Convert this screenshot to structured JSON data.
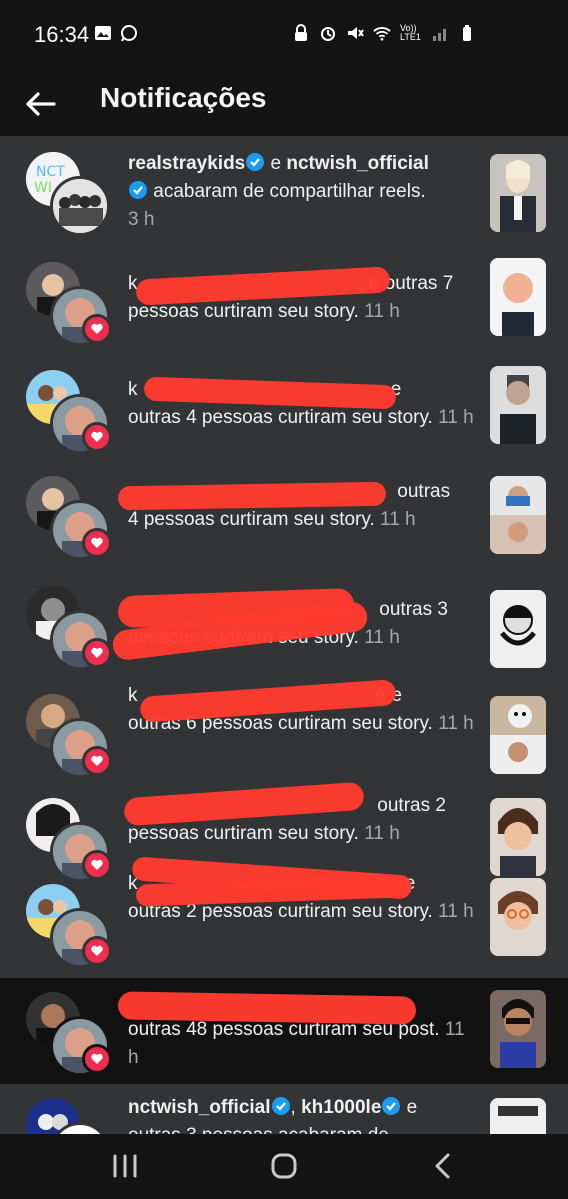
{
  "status_bar": {
    "time": "16:34",
    "left_icons": [
      "image-icon",
      "whatsapp-icon"
    ],
    "right_icons": [
      "lock-icon",
      "alarm-icon",
      "mute-icon",
      "wifi-icon",
      "volte-icon",
      "signal-icon",
      "battery-icon"
    ],
    "volte_label": "Vo)) LTE1"
  },
  "header": {
    "title": "Notificações"
  },
  "notifications": [
    {
      "user1": "realstraykids",
      "connector": " e ",
      "user2": "nctwish_official",
      "action": " acabaram de compartilhar reels.",
      "time": "3 h"
    },
    {
      "visible_fragment": "k",
      "action_prefix": " e outras 7",
      "action": "pessoas curtiram seu story.",
      "time": "11 h"
    },
    {
      "visible_fragment": "k",
      "action_prefix": " e",
      "action": "outras 4 pessoas curtiram seu story.",
      "time": "11 h"
    },
    {
      "action_prefix": " outras",
      "action": "4 pessoas curtiram seu story.",
      "time": "11 h"
    },
    {
      "action_prefix": " outras 3",
      "action": "pessoas curtiram seu story.",
      "time": "11 h"
    },
    {
      "visible_fragment": "k",
      "action_prefix": "e e",
      "action": "outras 6 pessoas curtiram seu story.",
      "time": "11 h"
    },
    {
      "action_prefix": " outras 2",
      "action": "pessoas curtiram seu story.",
      "time": "11 h"
    },
    {
      "visible_fragment": "k",
      "action_prefix": " e",
      "action": "outras 2 pessoas curtiram seu story.",
      "time": "11 h"
    },
    {
      "action": "outras 48 pessoas curtiram seu post.",
      "time": "11 h"
    },
    {
      "user1": "nctwish_official",
      "connector": ", ",
      "user2": "kh1000le",
      "action": " e outras 3 pessoas acabaram de"
    }
  ],
  "nav": {
    "recents": "recents-icon",
    "home": "home-icon",
    "back": "back-icon"
  },
  "colors": {
    "background": "#141414",
    "row_background": "#323436",
    "like_heart": "#ef2d4f",
    "verified": "#1d9bf0",
    "redaction": "#ff3b30"
  }
}
